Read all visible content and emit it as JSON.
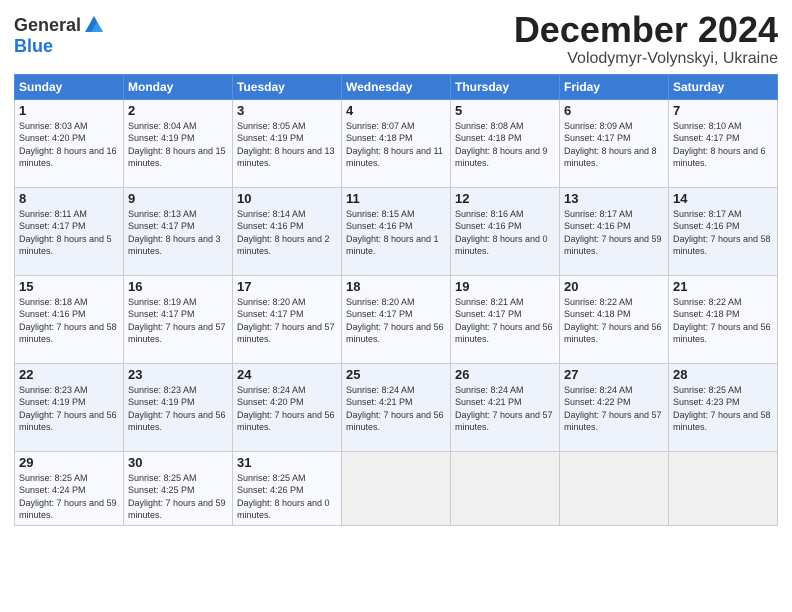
{
  "logo": {
    "general": "General",
    "blue": "Blue"
  },
  "title": "December 2024",
  "location": "Volodymyr-Volynskyi, Ukraine",
  "days_of_week": [
    "Sunday",
    "Monday",
    "Tuesday",
    "Wednesday",
    "Thursday",
    "Friday",
    "Saturday"
  ],
  "weeks": [
    [
      {
        "day": "1",
        "sunrise": "8:03 AM",
        "sunset": "4:20 PM",
        "daylight": "8 hours and 16 minutes."
      },
      {
        "day": "2",
        "sunrise": "8:04 AM",
        "sunset": "4:19 PM",
        "daylight": "8 hours and 15 minutes."
      },
      {
        "day": "3",
        "sunrise": "8:05 AM",
        "sunset": "4:19 PM",
        "daylight": "8 hours and 13 minutes."
      },
      {
        "day": "4",
        "sunrise": "8:07 AM",
        "sunset": "4:18 PM",
        "daylight": "8 hours and 11 minutes."
      },
      {
        "day": "5",
        "sunrise": "8:08 AM",
        "sunset": "4:18 PM",
        "daylight": "8 hours and 9 minutes."
      },
      {
        "day": "6",
        "sunrise": "8:09 AM",
        "sunset": "4:17 PM",
        "daylight": "8 hours and 8 minutes."
      },
      {
        "day": "7",
        "sunrise": "8:10 AM",
        "sunset": "4:17 PM",
        "daylight": "8 hours and 6 minutes."
      }
    ],
    [
      {
        "day": "8",
        "sunrise": "8:11 AM",
        "sunset": "4:17 PM",
        "daylight": "8 hours and 5 minutes."
      },
      {
        "day": "9",
        "sunrise": "8:13 AM",
        "sunset": "4:17 PM",
        "daylight": "8 hours and 3 minutes."
      },
      {
        "day": "10",
        "sunrise": "8:14 AM",
        "sunset": "4:16 PM",
        "daylight": "8 hours and 2 minutes."
      },
      {
        "day": "11",
        "sunrise": "8:15 AM",
        "sunset": "4:16 PM",
        "daylight": "8 hours and 1 minute."
      },
      {
        "day": "12",
        "sunrise": "8:16 AM",
        "sunset": "4:16 PM",
        "daylight": "8 hours and 0 minutes."
      },
      {
        "day": "13",
        "sunrise": "8:17 AM",
        "sunset": "4:16 PM",
        "daylight": "7 hours and 59 minutes."
      },
      {
        "day": "14",
        "sunrise": "8:17 AM",
        "sunset": "4:16 PM",
        "daylight": "7 hours and 58 minutes."
      }
    ],
    [
      {
        "day": "15",
        "sunrise": "8:18 AM",
        "sunset": "4:16 PM",
        "daylight": "7 hours and 58 minutes."
      },
      {
        "day": "16",
        "sunrise": "8:19 AM",
        "sunset": "4:17 PM",
        "daylight": "7 hours and 57 minutes."
      },
      {
        "day": "17",
        "sunrise": "8:20 AM",
        "sunset": "4:17 PM",
        "daylight": "7 hours and 57 minutes."
      },
      {
        "day": "18",
        "sunrise": "8:20 AM",
        "sunset": "4:17 PM",
        "daylight": "7 hours and 56 minutes."
      },
      {
        "day": "19",
        "sunrise": "8:21 AM",
        "sunset": "4:17 PM",
        "daylight": "7 hours and 56 minutes."
      },
      {
        "day": "20",
        "sunrise": "8:22 AM",
        "sunset": "4:18 PM",
        "daylight": "7 hours and 56 minutes."
      },
      {
        "day": "21",
        "sunrise": "8:22 AM",
        "sunset": "4:18 PM",
        "daylight": "7 hours and 56 minutes."
      }
    ],
    [
      {
        "day": "22",
        "sunrise": "8:23 AM",
        "sunset": "4:19 PM",
        "daylight": "7 hours and 56 minutes."
      },
      {
        "day": "23",
        "sunrise": "8:23 AM",
        "sunset": "4:19 PM",
        "daylight": "7 hours and 56 minutes."
      },
      {
        "day": "24",
        "sunrise": "8:24 AM",
        "sunset": "4:20 PM",
        "daylight": "7 hours and 56 minutes."
      },
      {
        "day": "25",
        "sunrise": "8:24 AM",
        "sunset": "4:21 PM",
        "daylight": "7 hours and 56 minutes."
      },
      {
        "day": "26",
        "sunrise": "8:24 AM",
        "sunset": "4:21 PM",
        "daylight": "7 hours and 57 minutes."
      },
      {
        "day": "27",
        "sunrise": "8:24 AM",
        "sunset": "4:22 PM",
        "daylight": "7 hours and 57 minutes."
      },
      {
        "day": "28",
        "sunrise": "8:25 AM",
        "sunset": "4:23 PM",
        "daylight": "7 hours and 58 minutes."
      }
    ],
    [
      {
        "day": "29",
        "sunrise": "8:25 AM",
        "sunset": "4:24 PM",
        "daylight": "7 hours and 59 minutes."
      },
      {
        "day": "30",
        "sunrise": "8:25 AM",
        "sunset": "4:25 PM",
        "daylight": "7 hours and 59 minutes."
      },
      {
        "day": "31",
        "sunrise": "8:25 AM",
        "sunset": "4:26 PM",
        "daylight": "8 hours and 0 minutes."
      },
      null,
      null,
      null,
      null
    ]
  ]
}
